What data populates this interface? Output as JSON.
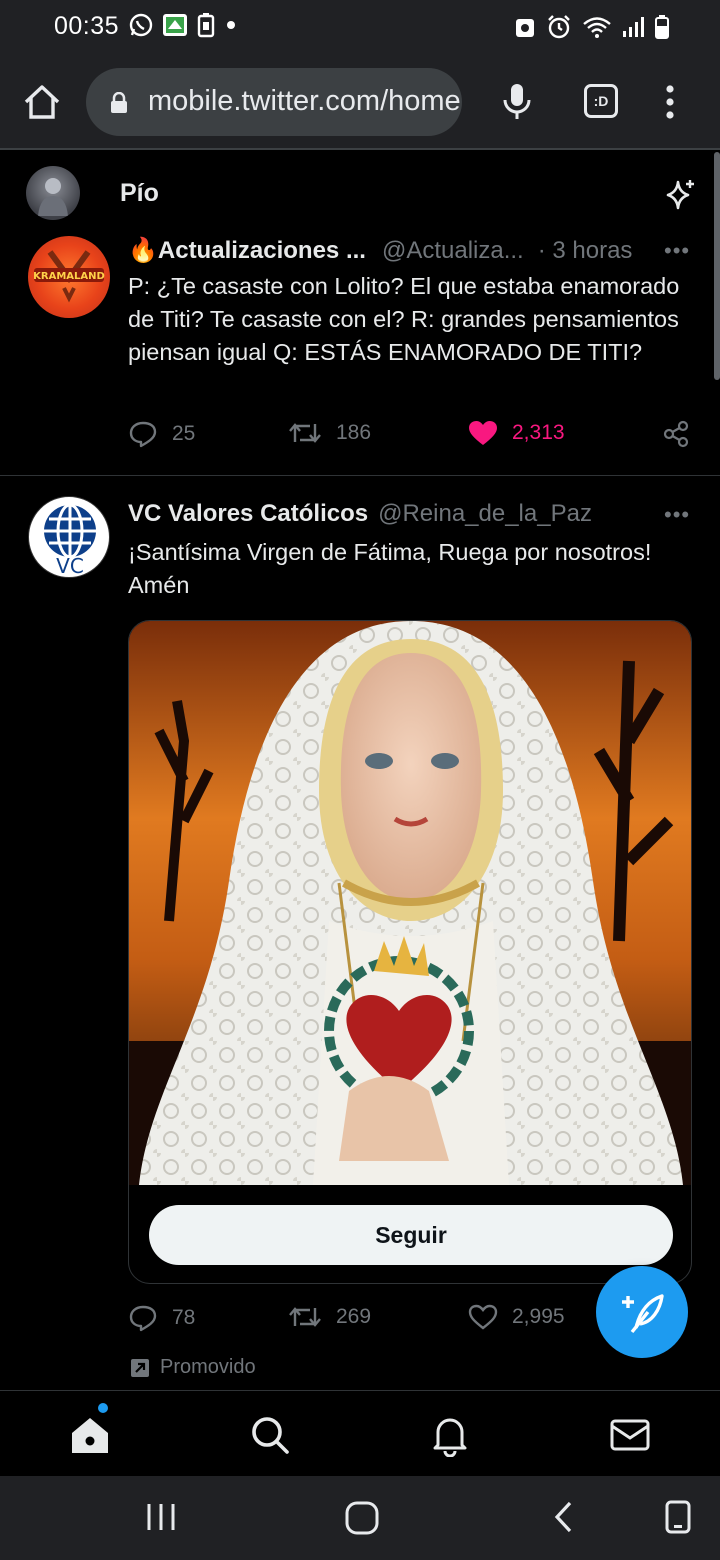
{
  "status_bar": {
    "time": "00:35"
  },
  "browser": {
    "url": "mobile.twitter.com/home",
    "tabs_label": ":D"
  },
  "header": {
    "title": "Pío"
  },
  "tweets": [
    {
      "display_name": "🔥Actualizaciones ...",
      "handle": "@Actualiza...",
      "time": "· 3 horas",
      "text": "P: ¿Te casaste con Lolito? El que estaba enamorado de Titi? Te casaste con el? R: grandes pensamientos piensan igual Q: ESTÁS ENAMORADO DE TITI?",
      "replies": "25",
      "retweets": "186",
      "likes": "2,313",
      "liked": true,
      "avatar_text": "KRAMALAND"
    },
    {
      "display_name": "VC Valores Católicos",
      "handle": "@Reina_de_la_Paz",
      "text": "¡Santísima Virgen de Fátima, Ruega por nosotros! Amén",
      "follow_label": "Seguir",
      "replies": "78",
      "retweets": "269",
      "likes": "2,995",
      "promoted_label": "Promovido",
      "avatar_text": "VC"
    }
  ],
  "colors": {
    "like_pink": "#f91880",
    "twitter_blue": "#1d9bf0",
    "secondary_text": "#71767b"
  }
}
